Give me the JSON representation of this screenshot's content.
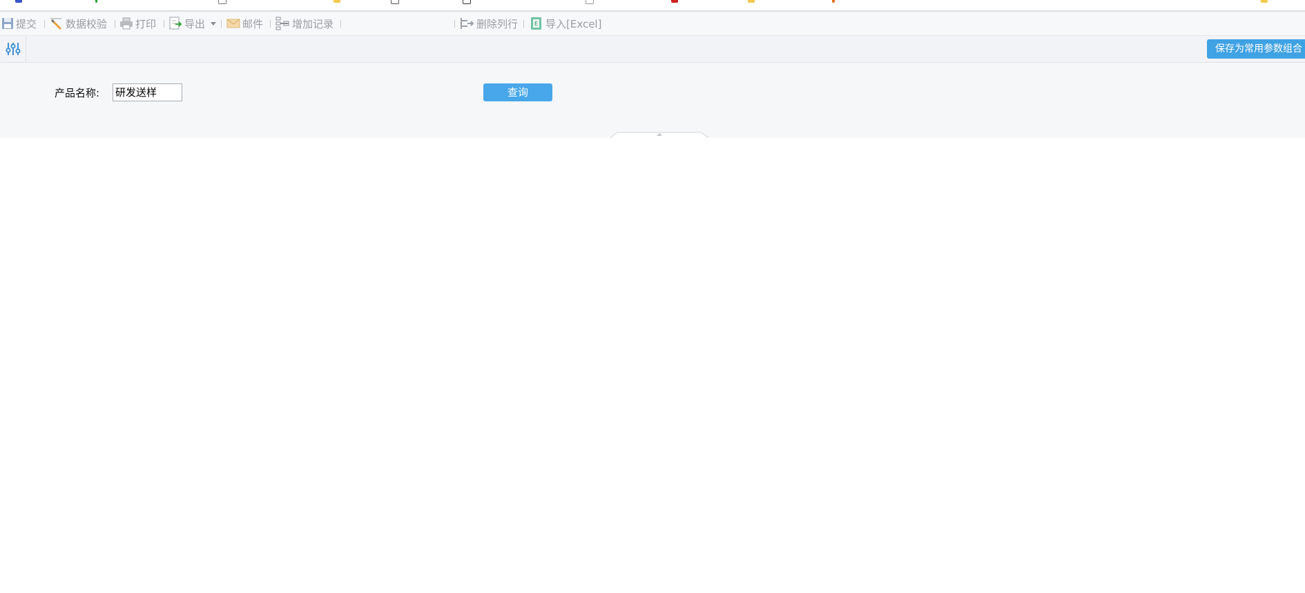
{
  "toolbar": {
    "items": [
      {
        "label": "提交",
        "icon": "save-icon"
      },
      {
        "label": "数据校验",
        "icon": "validate-icon"
      },
      {
        "label": "打印",
        "icon": "print-icon"
      },
      {
        "label": "导出",
        "icon": "export-icon"
      },
      {
        "label": "邮件",
        "icon": "mail-icon"
      },
      {
        "label": "增加记录",
        "icon": "add-record-icon"
      },
      {
        "label": "删除列行",
        "icon": "delete-row-icon"
      },
      {
        "label": "导入[Excel]",
        "icon": "excel-import-icon"
      }
    ]
  },
  "params": {
    "save_label": "保存为常用参数组合",
    "field_label": "产品名称:",
    "field_value": "研发送样",
    "query_label": "查询"
  },
  "colors": {
    "accent": "#48a7ea",
    "toolbar_text": "#9a9ca0",
    "panel_bg": "#f6f7f9"
  }
}
